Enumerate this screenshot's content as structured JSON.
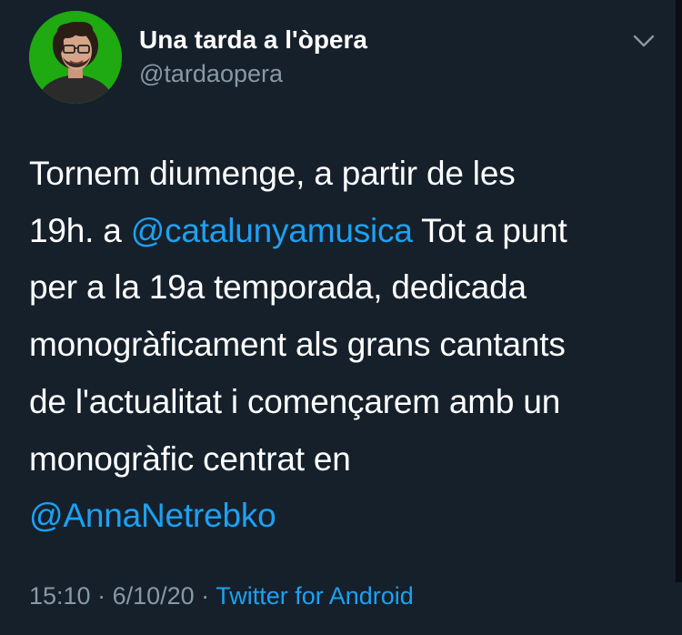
{
  "account": {
    "display_name": "Una tarda a l'òpera",
    "handle": "@tardaopera",
    "avatar_bg": "#1eaa10"
  },
  "more_icon": "chevron-down-icon",
  "tweet": {
    "lines": [
      {
        "before": "Tornem diumenge, a partir de les",
        "mention": "",
        "after": ""
      },
      {
        "before": "19h. a ",
        "mention": "@catalunyamusica",
        "after": " Tot a punt"
      },
      {
        "before": "per a la 19a temporada, dedicada",
        "mention": "",
        "after": ""
      },
      {
        "before": "monogràficament als grans cantants",
        "mention": "",
        "after": ""
      },
      {
        "before": "de l'actualitat i començarem amb un",
        "mention": "",
        "after": ""
      },
      {
        "before": "monogràfic centrat en",
        "mention": "",
        "after": ""
      },
      {
        "before": "",
        "mention": "@AnnaNetrebko",
        "after": ""
      }
    ]
  },
  "meta": {
    "time": "15:10",
    "sep1": " · ",
    "date": "6/10/20",
    "sep2": " · ",
    "source": "Twitter for Android"
  },
  "colors": {
    "background": "#15202b",
    "link": "#1da1f2",
    "secondary_text": "#8899a6"
  }
}
